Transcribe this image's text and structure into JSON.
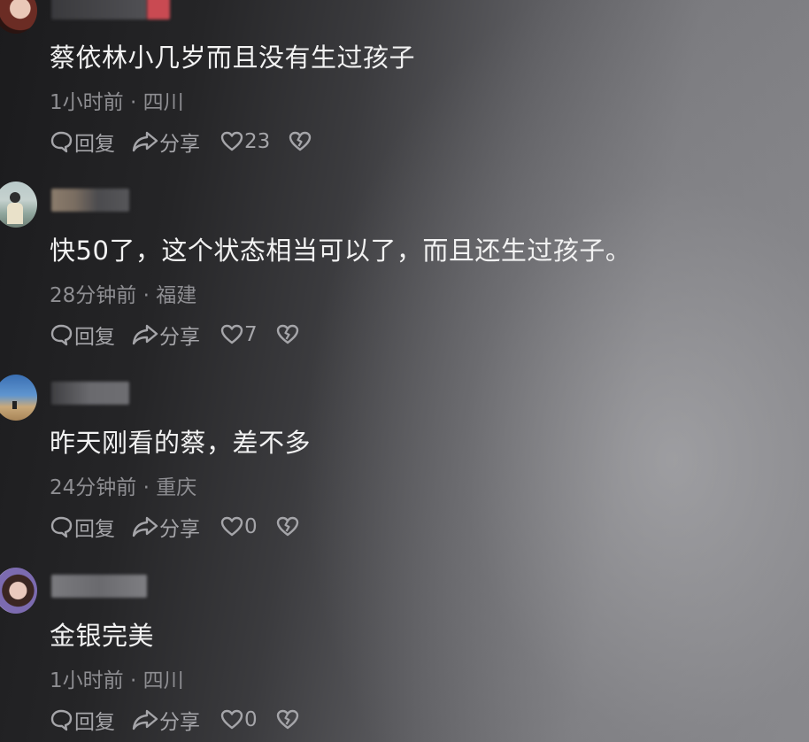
{
  "comments": [
    {
      "text": "蔡依林小几岁而且没有生过孩子",
      "time": "1小时前",
      "location": "四川",
      "reply_label": "回复",
      "share_label": "分享",
      "likes": "23"
    },
    {
      "text": "快50了，这个状态相当可以了，而且还生过孩子。",
      "time": "28分钟前",
      "location": "福建",
      "reply_label": "回复",
      "share_label": "分享",
      "likes": "7"
    },
    {
      "text": "昨天刚看的蔡，差不多",
      "time": "24分钟前",
      "location": "重庆",
      "reply_label": "回复",
      "share_label": "分享",
      "likes": "0"
    },
    {
      "text": "金银完美",
      "time": "1小时前",
      "location": "四川",
      "reply_label": "回复",
      "share_label": "分享",
      "likes": "0"
    }
  ],
  "meta_separator": " · "
}
